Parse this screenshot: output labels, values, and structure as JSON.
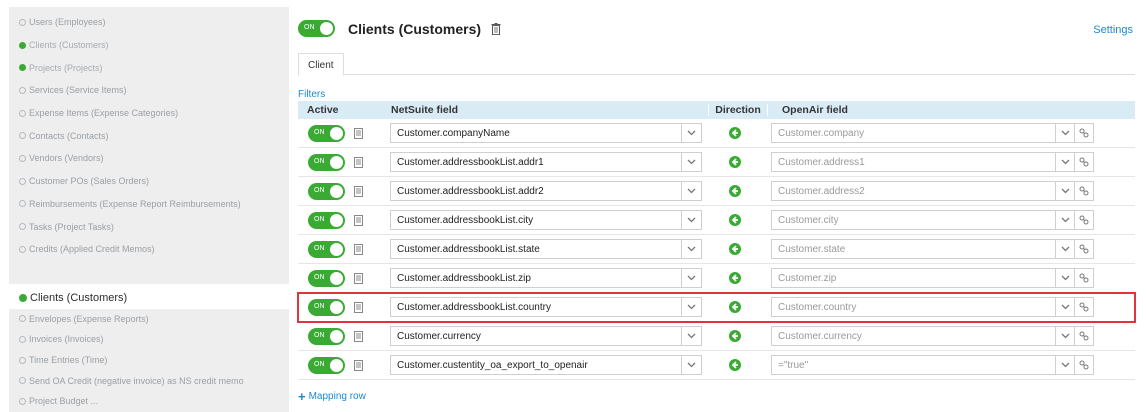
{
  "sidebar": {
    "group1": [
      {
        "label": "Users (Employees)",
        "enabled": false
      },
      {
        "label": "Clients (Customers)",
        "enabled": true
      },
      {
        "label": "Projects (Projects)",
        "enabled": true
      },
      {
        "label": "Services (Service Items)",
        "enabled": false
      },
      {
        "label": "Expense Items (Expense Categories)",
        "enabled": false
      },
      {
        "label": "Contacts (Contacts)",
        "enabled": false
      },
      {
        "label": "Vendors (Vendors)",
        "enabled": false
      },
      {
        "label": "Customer POs (Sales Orders)",
        "enabled": false
      },
      {
        "label": "Reimbursements (Expense Report Reimbursements)",
        "enabled": false
      },
      {
        "label": "Tasks (Project Tasks)",
        "enabled": false
      },
      {
        "label": "Credits (Applied Credit Memos)",
        "enabled": false
      }
    ],
    "current": "Clients (Customers)",
    "group2": [
      {
        "label": "Envelopes (Expense Reports)",
        "enabled": false
      },
      {
        "label": "Invoices (Invoices)",
        "enabled": false
      },
      {
        "label": "Time Entries (Time)",
        "enabled": false
      },
      {
        "label": "Send OA Credit (negative invoice) as NS credit memo",
        "enabled": false
      },
      {
        "label": "Project Budget ...",
        "enabled": false
      }
    ]
  },
  "header": {
    "toggle_label": "ON",
    "title": "Clients (Customers)",
    "settings_label": "Settings"
  },
  "tabs": [
    {
      "label": "Client"
    }
  ],
  "filters_label": "Filters",
  "table": {
    "columns": {
      "active": "Active",
      "netsuite": "NetSuite field",
      "direction": "Direction",
      "openair": "OpenAir field"
    },
    "rows": [
      {
        "active": "ON",
        "netsuite": "Customer.companyName",
        "openair": "Customer.company"
      },
      {
        "active": "ON",
        "netsuite": "Customer.addressbookList.addr1",
        "openair": "Customer.address1"
      },
      {
        "active": "ON",
        "netsuite": "Customer.addressbookList.addr2",
        "openair": "Customer.address2"
      },
      {
        "active": "ON",
        "netsuite": "Customer.addressbookList.city",
        "openair": "Customer.city"
      },
      {
        "active": "ON",
        "netsuite": "Customer.addressbookList.state",
        "openair": "Customer.state"
      },
      {
        "active": "ON",
        "netsuite": "Customer.addressbookList.zip",
        "openair": "Customer.zip"
      },
      {
        "active": "ON",
        "netsuite": "Customer.addressbookList.country",
        "openair": "Customer.country",
        "highlighted": true
      },
      {
        "active": "ON",
        "netsuite": "Customer.currency",
        "openair": "Customer.currency"
      },
      {
        "active": "ON",
        "netsuite": "Customer.custentity_oa_export_to_openair",
        "openair": "=\"true\""
      }
    ]
  },
  "add_row_label": "Mapping row",
  "colors": {
    "toggle_on": "#3aaa35",
    "link": "#1b8ad1",
    "header_bg": "#d9ecf6",
    "highlight": "#e0343b"
  }
}
